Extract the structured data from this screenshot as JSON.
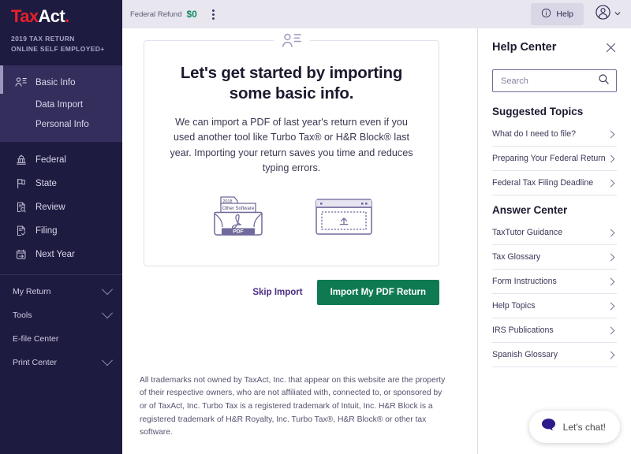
{
  "sidebar": {
    "logo": {
      "part1": "Tax",
      "part2": "Act",
      "trademark": "."
    },
    "tax_year_line": "2019 TAX RETURN",
    "product_line": "ONLINE SELF EMPLOYED+",
    "active_group": {
      "item": {
        "label": "Basic Info",
        "icon": "person-list-icon"
      },
      "subitems": [
        {
          "label": "Data Import"
        },
        {
          "label": "Personal Info"
        }
      ]
    },
    "items": [
      {
        "label": "Federal",
        "icon": "capitol-icon"
      },
      {
        "label": "State",
        "icon": "flag-icon"
      },
      {
        "label": "Review",
        "icon": "document-search-icon"
      },
      {
        "label": "Filing",
        "icon": "document-check-icon"
      },
      {
        "label": "Next Year",
        "icon": "calendar-arrow-icon"
      }
    ],
    "footer_items": [
      {
        "label": "My Return",
        "expandable": true
      },
      {
        "label": "Tools",
        "expandable": true
      },
      {
        "label": "E-file Center",
        "expandable": false
      },
      {
        "label": "Print Center",
        "expandable": true
      }
    ]
  },
  "topbar": {
    "refund_label": "Federal Refund",
    "refund_amount": "$0",
    "menu_icon": "kebab-menu-icon",
    "help_label": "Help",
    "help_icon": "info-circle-icon",
    "account_icon": "user-circle-icon",
    "account_chevron": "chevron-down-icon"
  },
  "card": {
    "top_icon": "person-list-icon",
    "title": "Let's get started by importing some basic info.",
    "body": "We can import a PDF of last year's return even if you used another tool like Turbo Tax® or H&R Block® last year. Importing your return saves you time and reduces typing errors.",
    "illustrations": [
      {
        "name": "pdf-folder-illustration",
        "tab_label": "2018",
        "inner_label": "Other Software",
        "footer_label": "PDF"
      },
      {
        "name": "browser-upload-illustration"
      }
    ]
  },
  "actions": {
    "skip_label": "Skip Import",
    "import_label": "Import My PDF Return"
  },
  "footer": {
    "text": "All trademarks not owned by TaxAct, Inc. that appear on this website are the property of their respective owners, who are not affiliated with, connected to, or sponsored by or of TaxAct, Inc. Turbo Tax is a registered trademark of Intuit, Inc. H&R Block is a registered trademark of H&R Royalty, Inc. Turbo Tax®, H&R Block® or other tax software."
  },
  "help_panel": {
    "title": "Help Center",
    "close_icon": "close-icon",
    "search": {
      "value": "",
      "placeholder": "Search",
      "icon": "search-icon"
    },
    "suggested_title": "Suggested Topics",
    "suggested_topics": [
      {
        "label": "What do I need to file?"
      },
      {
        "label": "Preparing Your Federal Return"
      },
      {
        "label": "Federal Tax Filing Deadline"
      }
    ],
    "answer_title": "Answer Center",
    "answer_items": [
      {
        "label": "TaxTutor Guidance"
      },
      {
        "label": "Tax Glossary"
      },
      {
        "label": "Form Instructions"
      },
      {
        "label": "Help Topics"
      },
      {
        "label": "IRS Publications"
      },
      {
        "label": "Spanish Glossary"
      }
    ]
  },
  "chat": {
    "label": "Let's chat!",
    "icon": "chat-bubble-icon"
  },
  "colors": {
    "sidebar_bg": "#1e1b40",
    "sidebar_active": "#332e5c",
    "brand_red": "#e8202a",
    "primary_green": "#0f7a52",
    "refund_green": "#0e8a5f",
    "link_purple": "#4b2e83",
    "topbar_bg": "#e8e7f0",
    "illustration_purple": "#6f6a9b"
  }
}
